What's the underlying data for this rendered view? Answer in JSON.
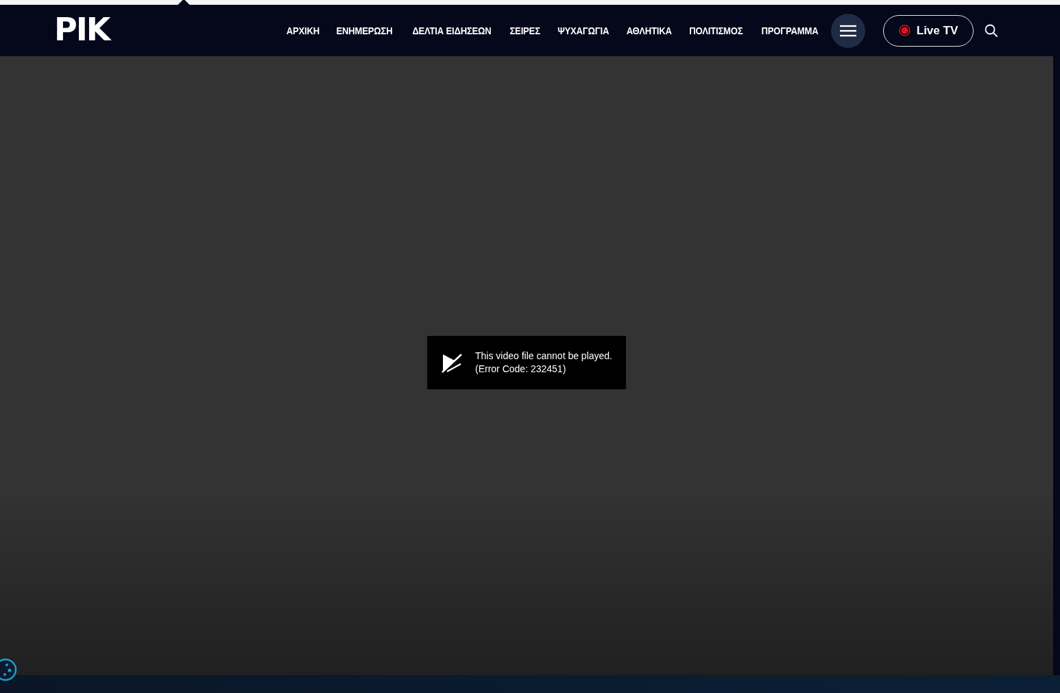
{
  "header": {
    "logo": "ΡΙΚ",
    "nav": [
      {
        "label": "ΑΡΧΙΚΗ"
      },
      {
        "label": "ΕΝΗΜΕΡΩΣΗ"
      },
      {
        "label": "ΔΕΛΤΙΑ ΕΙΔΗΣΕΩΝ"
      },
      {
        "label": "ΣΕΙΡΕΣ"
      },
      {
        "label": "ΨΥΧΑΓΩΓΙΑ"
      },
      {
        "label": "ΑΘΛΗΤΙΚΑ"
      },
      {
        "label": "ΠΟΛΙΤΙΣΜΟΣ"
      },
      {
        "label": "ΠΡΟΓΡΑΜΜΑ"
      }
    ],
    "live_button": {
      "label": "Live TV"
    }
  },
  "player": {
    "error": {
      "message": "This video file cannot be played.",
      "code": "(Error Code: 232451)"
    }
  }
}
